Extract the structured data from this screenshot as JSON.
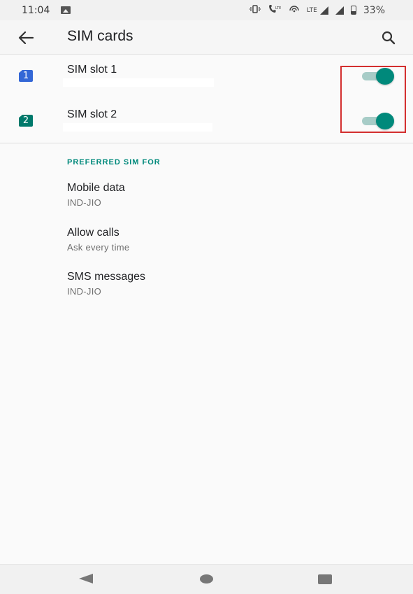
{
  "status_bar": {
    "time": "11:04",
    "lte_label": "LTE",
    "battery": "33%",
    "icons": [
      "image-icon",
      "vibrate-icon",
      "volte-icon",
      "hotspot-icon",
      "signal-icon",
      "battery-icon"
    ]
  },
  "app_bar": {
    "title": "SIM cards",
    "back_icon": "arrow-back-icon",
    "search_icon": "search-icon"
  },
  "sims": [
    {
      "badge": "1",
      "label": "SIM slot 1",
      "enabled": true,
      "badge_color": "#3367d6"
    },
    {
      "badge": "2",
      "label": "SIM slot 2",
      "enabled": true,
      "badge_color": "#00796b"
    }
  ],
  "preferred": {
    "header": "PREFERRED SIM FOR",
    "items": [
      {
        "title": "Mobile data",
        "subtitle": "IND-JIO"
      },
      {
        "title": "Allow calls",
        "subtitle": "Ask every time"
      },
      {
        "title": "SMS messages",
        "subtitle": "IND-JIO"
      }
    ]
  },
  "colors": {
    "accent": "#00897b",
    "toggle_track": "#a7ccc7",
    "highlight": "#d32f2f"
  },
  "nav_bar": {
    "back_icon": "nav-back-icon",
    "home_icon": "nav-home-icon",
    "recents_icon": "nav-recents-icon"
  }
}
